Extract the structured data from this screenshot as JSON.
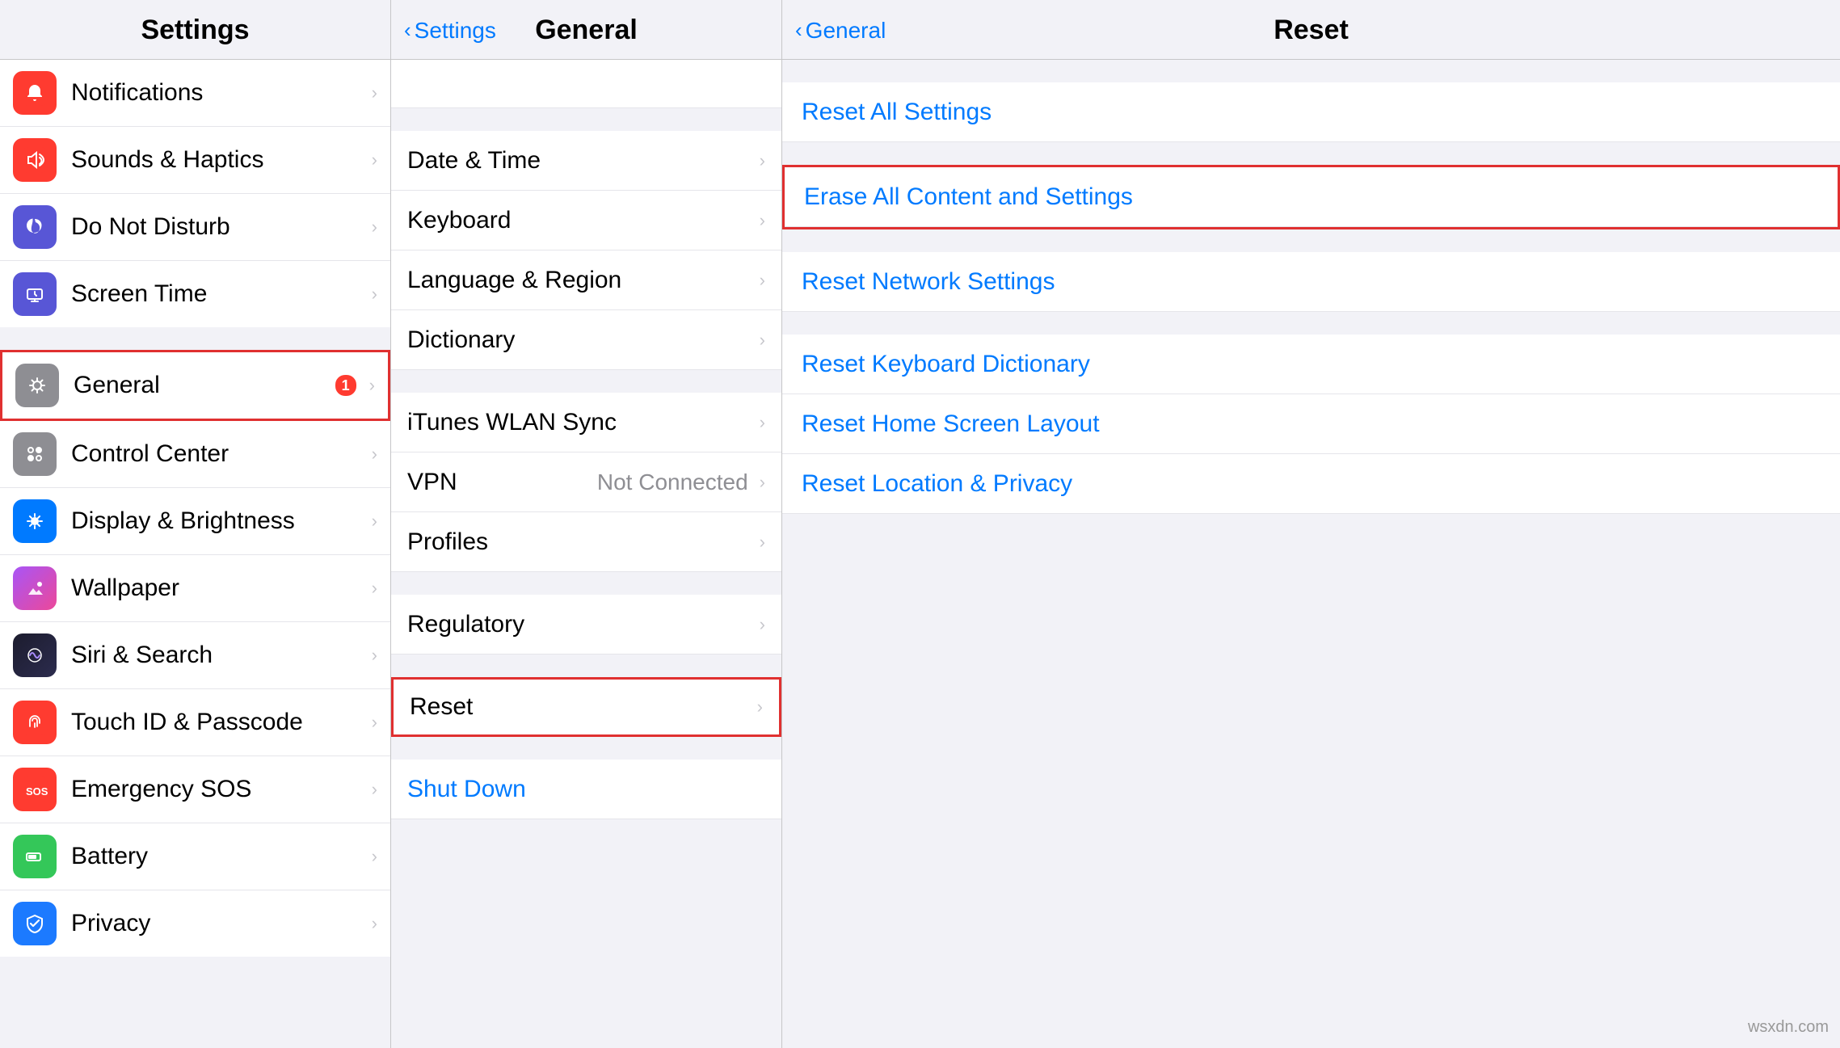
{
  "settings": {
    "title": "Settings",
    "items": [
      {
        "id": "notifications",
        "label": "Notifications",
        "icon": "notifications",
        "iconBg": "#ff3b30",
        "badge": null,
        "highlighted": false
      },
      {
        "id": "sounds",
        "label": "Sounds & Haptics",
        "icon": "sounds",
        "iconBg": "#ff3b30",
        "badge": null,
        "highlighted": false
      },
      {
        "id": "donotdisturb",
        "label": "Do Not Disturb",
        "icon": "donotdisturb",
        "iconBg": "#5856d6",
        "badge": null,
        "highlighted": false
      },
      {
        "id": "screentime",
        "label": "Screen Time",
        "icon": "screentime",
        "iconBg": "#5856d6",
        "badge": null,
        "highlighted": false
      },
      {
        "id": "general",
        "label": "General",
        "icon": "general",
        "iconBg": "#8e8e93",
        "badge": "1",
        "highlighted": true
      },
      {
        "id": "controlcenter",
        "label": "Control Center",
        "icon": "controlcenter",
        "iconBg": "#8e8e93",
        "badge": null,
        "highlighted": false
      },
      {
        "id": "displaybrightness",
        "label": "Display & Brightness",
        "icon": "displaybrightness",
        "iconBg": "#007aff",
        "badge": null,
        "highlighted": false
      },
      {
        "id": "wallpaper",
        "label": "Wallpaper",
        "icon": "wallpaper",
        "iconBg": "#8b5cf6",
        "badge": null,
        "highlighted": false
      },
      {
        "id": "siri",
        "label": "Siri & Search",
        "icon": "siri",
        "iconBg": "#000",
        "badge": null,
        "highlighted": false
      },
      {
        "id": "touchid",
        "label": "Touch ID & Passcode",
        "icon": "touchid",
        "iconBg": "#ff3b30",
        "badge": null,
        "highlighted": false
      },
      {
        "id": "emergencysos",
        "label": "Emergency SOS",
        "icon": "emergencysos",
        "iconBg": "#ff3b30",
        "badge": null,
        "highlighted": false
      },
      {
        "id": "battery",
        "label": "Battery",
        "icon": "battery",
        "iconBg": "#34c759",
        "badge": null,
        "highlighted": false
      },
      {
        "id": "privacy",
        "label": "Privacy",
        "icon": "privacy",
        "iconBg": "#1c7aff",
        "badge": null,
        "highlighted": false
      }
    ]
  },
  "general": {
    "back_label": "Settings",
    "title": "General",
    "items_top": [
      {
        "id": "datetime",
        "label": "Date & Time",
        "value": "",
        "highlighted": false
      },
      {
        "id": "keyboard",
        "label": "Keyboard",
        "value": "",
        "highlighted": false
      },
      {
        "id": "language",
        "label": "Language & Region",
        "value": "",
        "highlighted": false
      },
      {
        "id": "dictionary",
        "label": "Dictionary",
        "value": "",
        "highlighted": false
      }
    ],
    "items_mid": [
      {
        "id": "ituneswlan",
        "label": "iTunes WLAN Sync",
        "value": "",
        "highlighted": false
      },
      {
        "id": "vpn",
        "label": "VPN",
        "value": "Not Connected",
        "highlighted": false
      },
      {
        "id": "profiles",
        "label": "Profiles",
        "value": "",
        "highlighted": false
      }
    ],
    "items_bot": [
      {
        "id": "regulatory",
        "label": "Regulatory",
        "value": "",
        "highlighted": false
      }
    ],
    "items_reset": [
      {
        "id": "reset",
        "label": "Reset",
        "value": "",
        "highlighted": true
      }
    ],
    "shutdown_label": "Shut Down",
    "partial_top_label": ""
  },
  "reset": {
    "back_label": "General",
    "title": "Reset",
    "items": [
      {
        "id": "reset-all-settings",
        "label": "Reset All Settings",
        "highlighted": false
      },
      {
        "id": "erase-all",
        "label": "Erase All Content and Settings",
        "highlighted": true
      },
      {
        "id": "reset-network",
        "label": "Reset Network Settings",
        "highlighted": false
      },
      {
        "id": "reset-keyboard",
        "label": "Reset Keyboard Dictionary",
        "highlighted": false
      },
      {
        "id": "reset-homescreen",
        "label": "Reset Home Screen Layout",
        "highlighted": false
      },
      {
        "id": "reset-location",
        "label": "Reset Location & Privacy",
        "highlighted": false
      }
    ]
  },
  "watermark": "wsxdn.com"
}
